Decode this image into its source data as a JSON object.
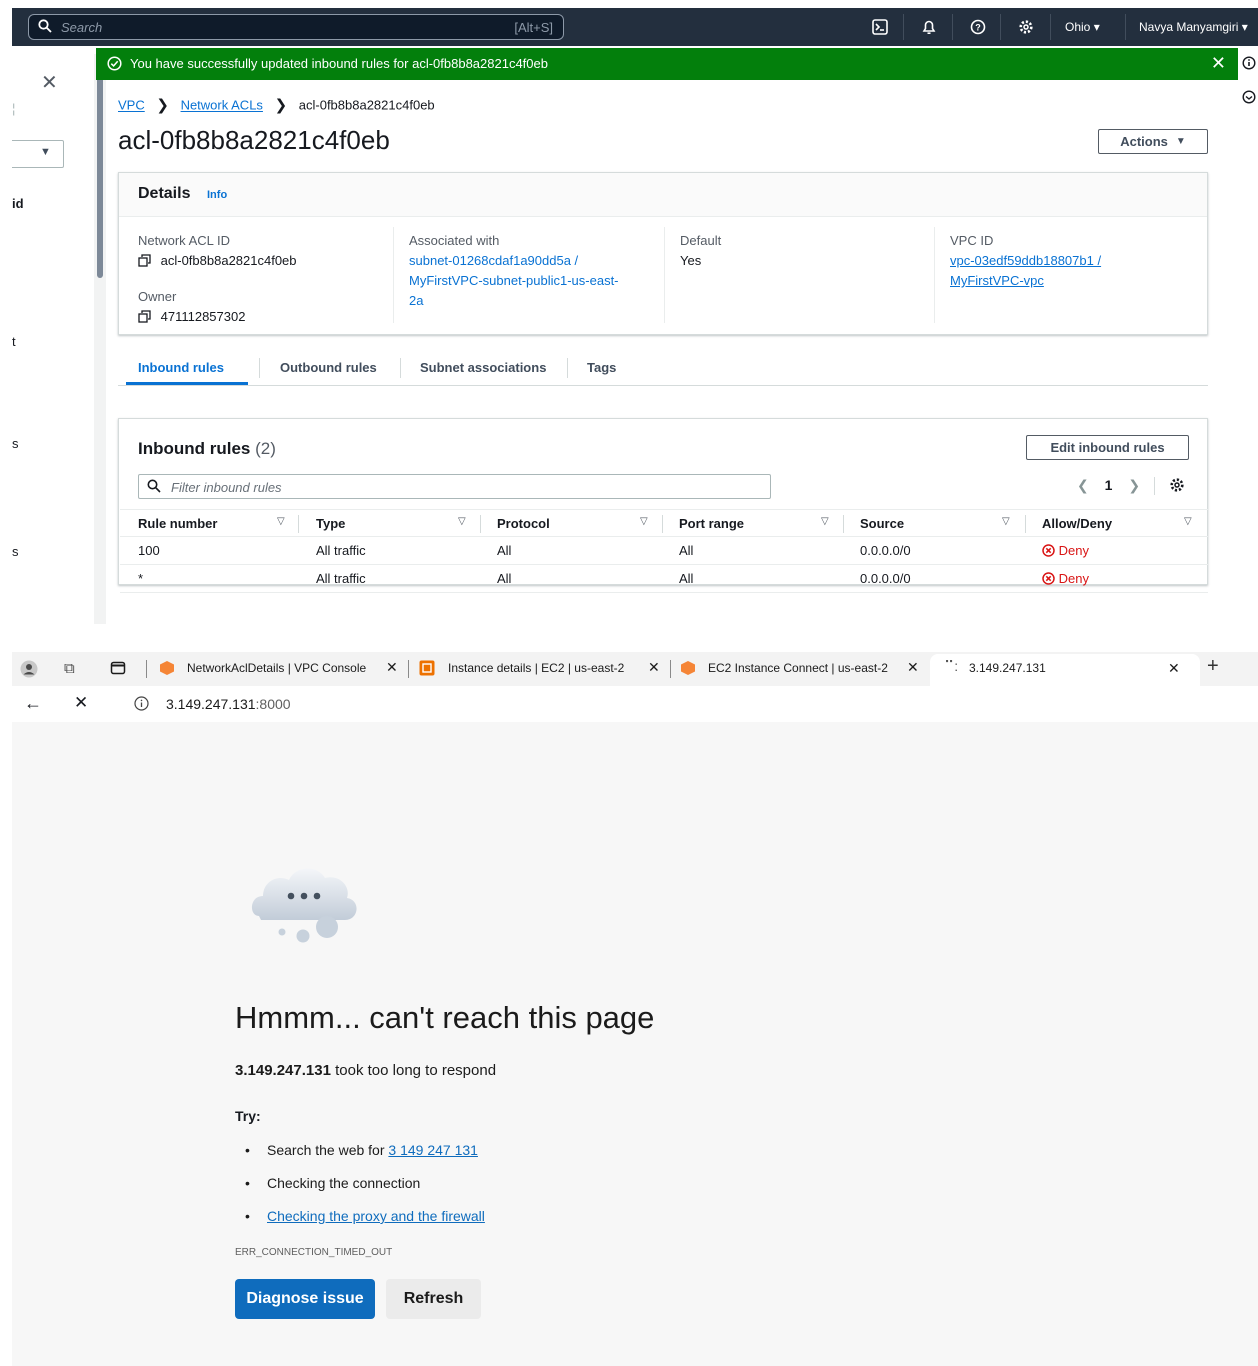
{
  "aws": {
    "search_placeholder": "Search",
    "search_shortcut": "[Alt+S]",
    "region": "Ohio",
    "user": "Navya Manyamgiri",
    "left_nav_fragments": [
      "id",
      "t",
      "s",
      "s"
    ],
    "flash_message": "You have successfully updated inbound rules for acl-0fb8b8a2821c4f0eb",
    "breadcrumbs": [
      "VPC",
      "Network ACLs",
      "acl-0fb8b8a2821c4f0eb"
    ],
    "page_title": "acl-0fb8b8a2821c4f0eb",
    "actions_label": "Actions",
    "details": {
      "title": "Details",
      "info": "Info",
      "network_acl_id_label": "Network ACL ID",
      "network_acl_id": "acl-0fb8b8a2821c4f0eb",
      "owner_label": "Owner",
      "owner": "471112857302",
      "associated_label": "Associated with",
      "associated_line1": "subnet-01268cdaf1a90dd5a /",
      "associated_line2": "MyFirstVPC-subnet-public1-us-east-",
      "associated_line3": "2a",
      "default_label": "Default",
      "default_value": "Yes",
      "vpc_label": "VPC ID",
      "vpc_line1": "vpc-03edf59ddb18807b1 /",
      "vpc_line2": "MyFirstVPC-vpc"
    },
    "tabs": [
      "Inbound rules",
      "Outbound rules",
      "Subnet associations",
      "Tags"
    ],
    "rules": {
      "title": "Inbound rules",
      "count": "(2)",
      "edit_label": "Edit inbound rules",
      "filter_placeholder": "Filter inbound rules",
      "page": "1",
      "columns": [
        "Rule number",
        "Type",
        "Protocol",
        "Port range",
        "Source",
        "Allow/Deny"
      ],
      "rows": [
        [
          "100",
          "All traffic",
          "All",
          "All",
          "0.0.0.0/0",
          "Deny"
        ],
        [
          "*",
          "All traffic",
          "All",
          "All",
          "0.0.0.0/0",
          "Deny"
        ]
      ]
    }
  },
  "browser": {
    "tabs": [
      "NetworkAclDetails | VPC Console",
      "Instance details | EC2 | us-east-2",
      "EC2 Instance Connect | us-east-2",
      "3.149.247.131"
    ],
    "url_host": "3.149.247.131",
    "url_port": ":8000",
    "error_title": "Hmmm... can't reach this page",
    "error_host": "3.149.247.131",
    "error_sub_rest": " took too long to respond",
    "try_label": "Try:",
    "suggestion1_prefix": "Search the web for ",
    "suggestion1_link": "3 149 247 131",
    "suggestion2": "Checking the connection",
    "suggestion3": "Checking the proxy and the firewall",
    "error_code": "ERR_CONNECTION_TIMED_OUT",
    "diagnose_label": "Diagnose issue",
    "refresh_label": "Refresh"
  }
}
